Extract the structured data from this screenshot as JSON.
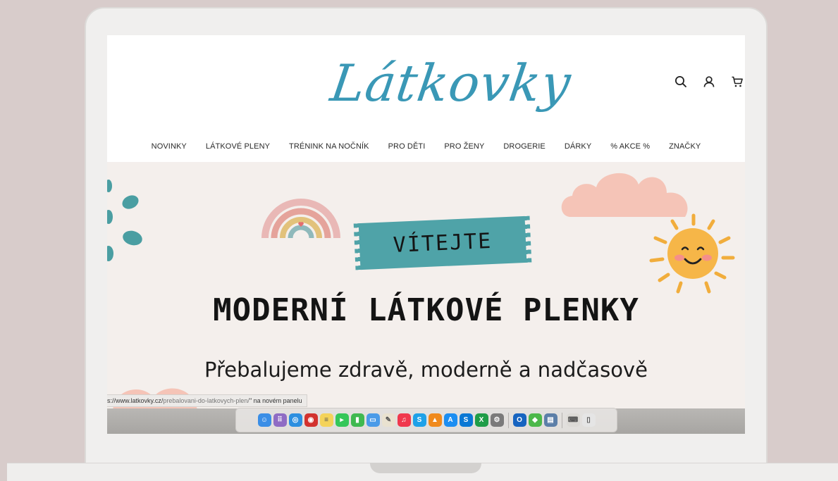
{
  "logo": {
    "text": "Látkovky",
    "color": "#3a98b6"
  },
  "header_icons": [
    "search-icon",
    "user-icon",
    "cart-icon"
  ],
  "nav": [
    "NOVINKY",
    "LÁTKOVÉ PLENY",
    "TRÉNINK NA NOČNÍK",
    "PRO DĚTI",
    "PRO ŽENY",
    "DROGERIE",
    "DÁRKY",
    "% AKCE %",
    "ZNAČKY"
  ],
  "banner": {
    "welcome": "VÍTEJTE",
    "headline": "MODERNÍ LÁTKOVÉ PLENKY",
    "subline": "Přebalujeme zdravě, moderně a nadčasově",
    "background": "#f4efec",
    "tag_color": "#4fa3a8"
  },
  "status_bar": {
    "url_prefix": "s://www.latkovky.cz/",
    "url_path": "prebalovani-do-latkovych-plen/",
    "suffix": "\" na novém panelu"
  },
  "dock": {
    "apps": [
      {
        "name": "finder-icon",
        "color": "#3a8ee6",
        "glyph": "☺"
      },
      {
        "name": "launchpad-icon",
        "color": "#8f6cc4",
        "glyph": "⠿"
      },
      {
        "name": "safari-icon",
        "color": "#2c8fe0",
        "glyph": "◎"
      },
      {
        "name": "photo-booth-icon",
        "color": "#d2322e",
        "glyph": "◉"
      },
      {
        "name": "notes-icon",
        "color": "#f4d35a",
        "glyph": "≡"
      },
      {
        "name": "facetime-icon",
        "color": "#35c759",
        "glyph": "▸"
      },
      {
        "name": "numbers-icon",
        "color": "#3fb950",
        "glyph": "▮"
      },
      {
        "name": "keynote-icon",
        "color": "#4a9be8",
        "glyph": "▭"
      },
      {
        "name": "textedit-icon",
        "color": "#e9e2d0",
        "glyph": "✎"
      },
      {
        "name": "music-icon",
        "color": "#f0384d",
        "glyph": "♫"
      },
      {
        "name": "skype-icon",
        "color": "#1ea1e8",
        "glyph": "S"
      },
      {
        "name": "vlc-icon",
        "color": "#f08a1c",
        "glyph": "▲"
      },
      {
        "name": "app-store-icon",
        "color": "#1b8ef2",
        "glyph": "A"
      },
      {
        "name": "skype-business-icon",
        "color": "#0a78d4",
        "glyph": "S"
      },
      {
        "name": "excel-icon",
        "color": "#1f9d48",
        "glyph": "X"
      },
      {
        "name": "system-preferences-icon",
        "color": "#7a7a7a",
        "glyph": "⚙"
      },
      {
        "name": "outlook-icon",
        "color": "#1664c0",
        "glyph": "O"
      },
      {
        "name": "security-icon",
        "color": "#4cb84a",
        "glyph": "◆"
      },
      {
        "name": "preview-icon",
        "color": "#5c7fa8",
        "glyph": "▤"
      },
      {
        "name": "keyboard-viewer-icon",
        "color": "#dcdad6",
        "glyph": "⌨"
      },
      {
        "name": "trash-icon",
        "color": "#e5e5e5",
        "glyph": "▯"
      }
    ]
  }
}
